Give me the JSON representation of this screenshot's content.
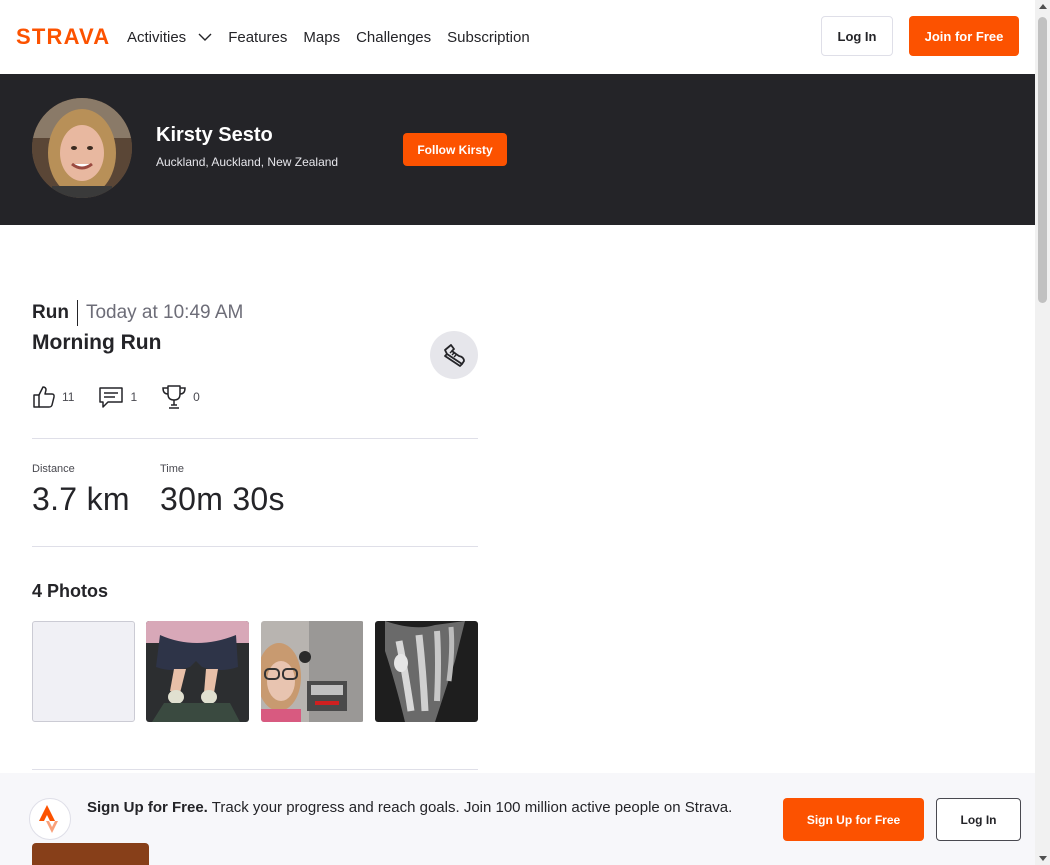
{
  "nav": {
    "logo_text": "STRAVA",
    "links": [
      "Activities",
      "Features",
      "Maps",
      "Challenges",
      "Subscription"
    ],
    "login_label": "Log In",
    "join_label": "Join for Free"
  },
  "athlete": {
    "name": "Kirsty Sesto",
    "location": "Auckland, Auckland, New Zealand",
    "follow_label": "Follow Kirsty"
  },
  "activity": {
    "type": "Run",
    "time": "Today at 10:49 AM",
    "title": "Morning Run",
    "sport_icon": "shoe-icon",
    "kudos_count": "11",
    "comment_count": "1",
    "achievement_count": "0",
    "stats": [
      {
        "label": "Distance",
        "value": "3.7 km"
      },
      {
        "label": "Time",
        "value": "30m 30s"
      }
    ],
    "photos_title": "4 Photos"
  },
  "signup_bar": {
    "headline": "Sign Up for Free.",
    "body": "Track your progress and reach goals. Join 100 million active people on Strava.",
    "signup_label": "Sign Up for Free",
    "login_label": "Log In"
  },
  "colors": {
    "brand": "#fc5200",
    "banner": "#242428"
  }
}
